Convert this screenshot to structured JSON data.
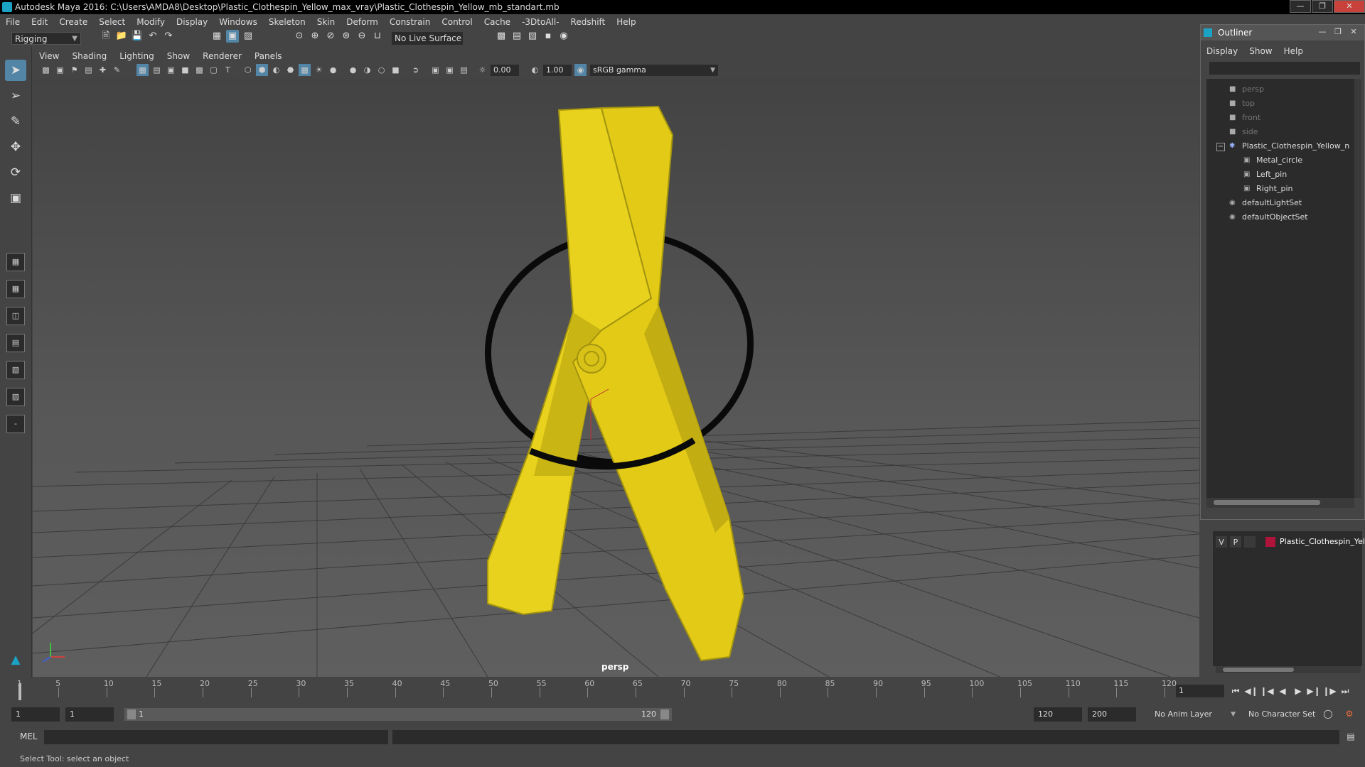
{
  "window": {
    "title": "Autodesk Maya 2016: C:\\Users\\AMDA8\\Desktop\\Plastic_Clothespin_Yellow_max_vray\\Plastic_Clothespin_Yellow_mb_standart.mb"
  },
  "menubar": [
    "File",
    "Edit",
    "Create",
    "Select",
    "Modify",
    "Display",
    "Windows",
    "Skeleton",
    "Skin",
    "Deform",
    "Constrain",
    "Control",
    "Cache",
    "-3DtoAll-",
    "Redshift",
    "Help"
  ],
  "statusline": {
    "mode": "Rigging",
    "live_surface": "No Live Surface"
  },
  "panel": {
    "menus": [
      "View",
      "Shading",
      "Lighting",
      "Show",
      "Renderer",
      "Panels"
    ],
    "exposure": "0.00",
    "gamma": "1.00",
    "colorspace": "sRGB gamma",
    "camera": "persp"
  },
  "outliner": {
    "title": "Outliner",
    "menus": [
      "Display",
      "Show",
      "Help"
    ],
    "items": [
      {
        "label": "persp",
        "icon": "camera-icon",
        "dim": true
      },
      {
        "label": "top",
        "icon": "camera-icon",
        "dim": true
      },
      {
        "label": "front",
        "icon": "camera-icon",
        "dim": true
      },
      {
        "label": "side",
        "icon": "camera-icon",
        "dim": true
      },
      {
        "label": "Plastic_Clothespin_Yellow_n",
        "icon": "group-icon",
        "dim": false
      },
      {
        "label": "Metal_circle",
        "icon": "mesh-icon",
        "dim": false
      },
      {
        "label": "Left_pin",
        "icon": "mesh-icon",
        "dim": false
      },
      {
        "label": "Right_pin",
        "icon": "mesh-icon",
        "dim": false
      },
      {
        "label": "defaultLightSet",
        "icon": "set-icon",
        "dim": false
      },
      {
        "label": "defaultObjectSet",
        "icon": "set-icon",
        "dim": false
      }
    ]
  },
  "layers": {
    "visibility": "V",
    "playback": "P",
    "name": "Plastic_Clothespin_Yell",
    "color": "#b0143a"
  },
  "timeline": {
    "ticks": [
      "1",
      "5",
      "10",
      "15",
      "20",
      "25",
      "30",
      "35",
      "40",
      "45",
      "50",
      "55",
      "60",
      "65",
      "70",
      "75",
      "80",
      "85",
      "90",
      "95",
      "100",
      "105",
      "110",
      "115",
      "120"
    ],
    "current_frame": "1"
  },
  "range": {
    "start": "1",
    "playback_start": "1",
    "slider_start": "1",
    "slider_end": "120",
    "playback_end": "120",
    "end": "200",
    "anim_layer": "No Anim Layer",
    "character_set": "No Character Set"
  },
  "cmdline": {
    "label": "MEL"
  },
  "helpline": {
    "text": "Select Tool: select an object"
  },
  "colors": {
    "accent": "#5285a6",
    "pin_yellow": "#e8d21d",
    "ring": "#0a0a0a",
    "maya_blue": "#1aa3c4"
  }
}
